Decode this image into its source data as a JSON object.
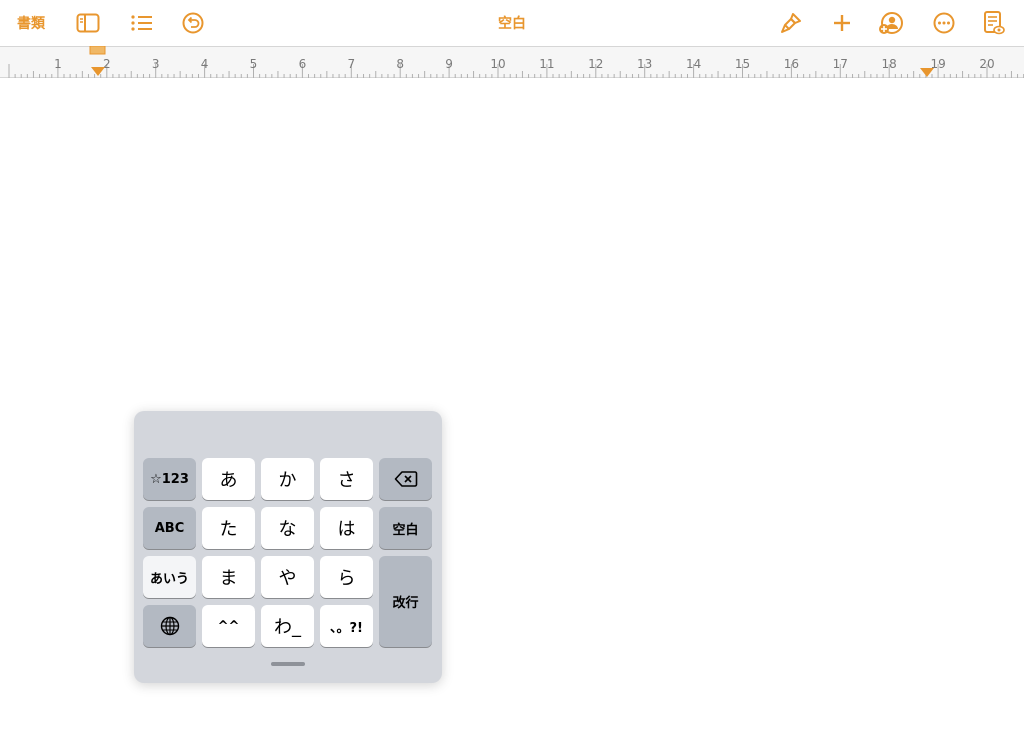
{
  "toolbar": {
    "documents_label": "書類",
    "title": "空白",
    "accent_color": "#e8962e",
    "left_icons": [
      "sidebar-icon",
      "list-icon",
      "undo-icon"
    ],
    "right_icons": [
      "paintbrush-icon",
      "plus-icon",
      "collaborate-icon",
      "more-icon",
      "reader-view-icon"
    ]
  },
  "ruler": {
    "numbers": [
      "1",
      "2",
      "3",
      "4",
      "5",
      "6",
      "7",
      "8",
      "9",
      "10",
      "11",
      "12",
      "13",
      "14",
      "15",
      "16",
      "17",
      "18",
      "19",
      "20"
    ]
  },
  "keyboard": {
    "rows": [
      [
        {
          "label": "☆123",
          "kind": "dark"
        },
        {
          "label": "あ",
          "kind": "light"
        },
        {
          "label": "か",
          "kind": "light"
        },
        {
          "label": "さ",
          "kind": "light"
        },
        {
          "label": "⌫",
          "kind": "dark",
          "icon": "delete-icon"
        }
      ],
      [
        {
          "label": "ABC",
          "kind": "dark"
        },
        {
          "label": "た",
          "kind": "light"
        },
        {
          "label": "な",
          "kind": "light"
        },
        {
          "label": "は",
          "kind": "light"
        },
        {
          "label": "空白",
          "kind": "dark"
        }
      ],
      [
        {
          "label": "あいう",
          "kind": "light"
        },
        {
          "label": "ま",
          "kind": "light"
        },
        {
          "label": "や",
          "kind": "light"
        },
        {
          "label": "ら",
          "kind": "light"
        },
        {
          "label": "改行",
          "kind": "dark"
        }
      ],
      [
        {
          "label": "🌐",
          "kind": "dark",
          "icon": "globe-icon"
        },
        {
          "label": "^^",
          "kind": "light"
        },
        {
          "label": "わ_",
          "kind": "light"
        },
        {
          "label": "、。?!",
          "kind": "light"
        }
      ]
    ]
  }
}
